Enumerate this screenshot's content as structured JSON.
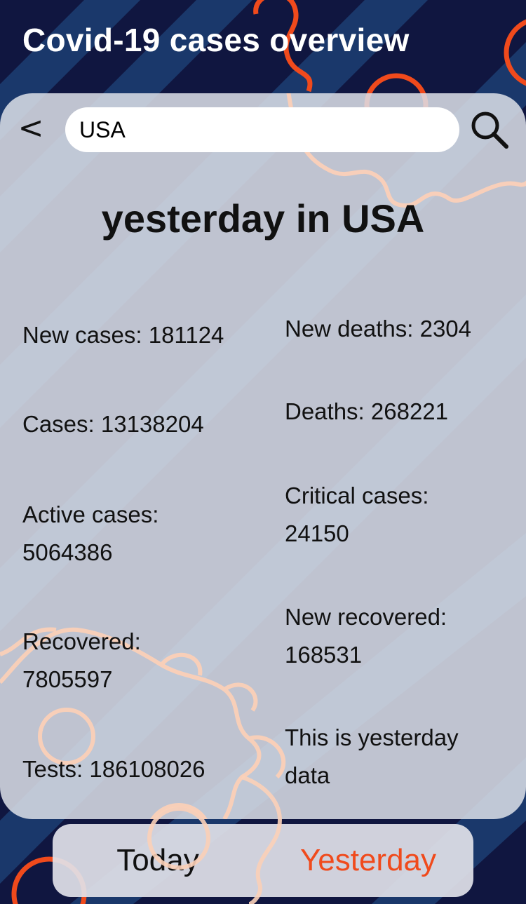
{
  "app": {
    "title": "Covid-19 cases overview"
  },
  "search": {
    "value": "USA",
    "back_label": "<"
  },
  "heading": "yesterday in USA",
  "stats": {
    "new_cases": "New cases: 181124",
    "new_deaths": "New deaths: 2304",
    "cases": "Cases: 13138204",
    "deaths": "Deaths: 268221",
    "active_label": "Active cases:",
    "active_value": "5064386",
    "critical_label": "Critical cases:",
    "critical_value": "24150",
    "recovered_label": "Recovered:",
    "recovered_value": "7805597",
    "new_recovered_label": "New recovered:",
    "new_recovered_value": "168531",
    "tests": "Tests: 186108026",
    "note_line1": "This is yesterday",
    "note_line2": "data"
  },
  "tabs": {
    "today": "Today",
    "yesterday": "Yesterday"
  },
  "colors": {
    "background": "#101640",
    "stripe": "#1c3c70",
    "accent": "#f04a1c",
    "virus_outline": "#fbd0b8"
  },
  "icons": {
    "search": "magnifier-icon",
    "back": "chevron-left-icon"
  }
}
